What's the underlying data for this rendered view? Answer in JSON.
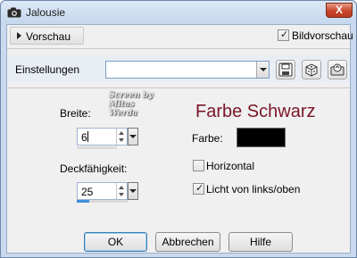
{
  "window": {
    "title": "Jalousie",
    "close_glyph": "X"
  },
  "preview": {
    "toggle_label": "Vorschau",
    "bildvorschau_label": "Bildvorschau",
    "bildvorschau_checked": true
  },
  "settings": {
    "label": "Einstellungen",
    "value": ""
  },
  "watermark": {
    "line1": "Screen by",
    "line2": "Mitas Werda"
  },
  "headline": "Farbe Schwarz",
  "breite": {
    "label": "Breite:",
    "value": "6"
  },
  "deckfaehigkeit": {
    "label": "Deckfähigkeit:",
    "value": "25",
    "level_percent": 25
  },
  "farbe": {
    "label": "Farbe:",
    "color": "#000000"
  },
  "horizontal": {
    "label": "Horizontal",
    "checked": false
  },
  "licht": {
    "label": "Licht von links/oben",
    "checked": true
  },
  "buttons": {
    "ok": "OK",
    "cancel": "Abbrechen",
    "help": "Hilfe"
  },
  "icons": [
    "app-icon",
    "save-preset-icon",
    "random-dice-icon",
    "reset-icon",
    "chevron-down-icon",
    "close-icon"
  ]
}
